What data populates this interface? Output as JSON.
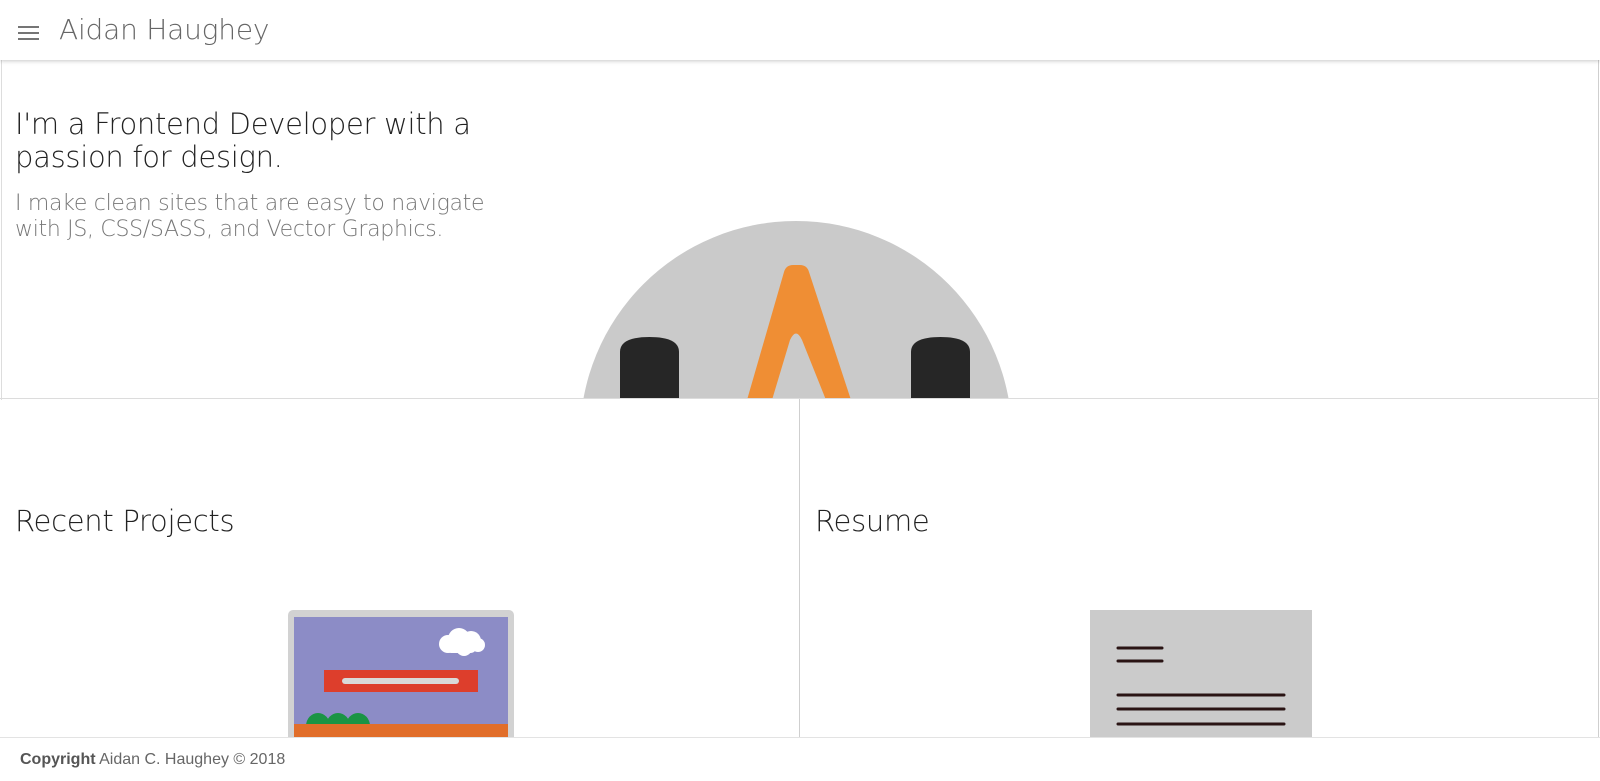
{
  "header": {
    "title": "Aidan Haughey",
    "menu_icon": "hamburger-menu-icon"
  },
  "hero": {
    "title": "I'm a Frontend Developer with a passion for design.",
    "subtitle": "I make clean sites that are easy to navigate with JS, CSS/SASS, and Vector Graphics.",
    "logo_icon": "a-monogram-logo-icon"
  },
  "cards": {
    "projects": {
      "heading": "Recent Projects",
      "illustration": "laptop-website-illustration"
    },
    "resume": {
      "heading": "Resume",
      "illustration": "resume-document-illustration"
    }
  },
  "footer": {
    "label": "Copyright",
    "text": "Aidan C. Haughey © 2018"
  },
  "colors": {
    "circle_gray": "#cacaca",
    "accent_orange": "#ef8e34",
    "dark": "#262626",
    "laptop_screen": "#8c8cc6",
    "banner_red": "#dd3e2c",
    "ground_orange": "#e16e2a",
    "tree_green": "#1a9444",
    "resume_paper": "#cbcbcb",
    "resume_lines": "#2a1414"
  }
}
